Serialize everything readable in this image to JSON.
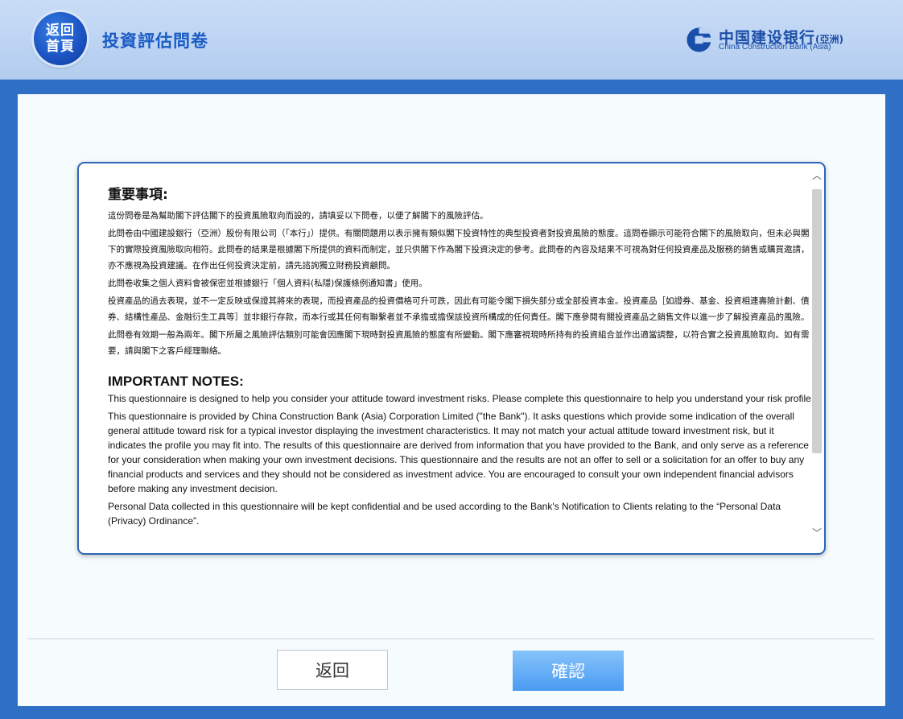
{
  "header": {
    "home_line1": "返回",
    "home_line2": "首頁",
    "title": "投資評估問卷",
    "logo_cn": "中国建设银行",
    "logo_cn_suffix": "(亞洲)",
    "logo_en": "China Construction Bank (Asia)",
    "icons": {
      "home": "home-circle-button",
      "logo": "ccb-logo-icon"
    }
  },
  "notice": {
    "heading_cn": "重要事項:",
    "paragraphs_cn": [
      "這份問卷是為幫助閣下評估閣下的投資風險取向而設的，請填妥以下問卷，以便了解閣下的風險評估。",
      "此問卷由中國建設銀行（亞洲）股份有限公司（「本行」）提供。有關問題用以表示擁有類似閣下投資特性的典型投資者對投資風險的態度。這問卷顯示可能符合閣下的風險取向，但未必與閣下的實際投資風險取向相符。此問卷的結果是根據閣下所提供的資料而制定，並只供閣下作為閣下投資決定的參考。此問卷的內容及結果不可視為對任何投資產品及服務的銷售或購買邀請，亦不應視為投資建議。在作出任何投資決定前，請先諮詢獨立財務投資顧問。",
      "此問卷收集之個人資料會被保密並根據銀行「個人資料(私隱)保護條例通知書」使用。",
      "投資產品的過去表現，並不一定反映或保證其將來的表現，而投資產品的投資價格可升可跌，因此有可能令閣下損失部分或全部投資本金。投資產品［如證券、基金、投資相連壽險計劃、債券、結構性產品、金融衍生工具等］並非銀行存款，而本行或其任何有聯繫者並不承擔或擔保該投資所構成的任何責任。閣下應參閱有關投資產品之銷售文件以進一步了解投資產品的風險。",
      "此問卷有效期一般為兩年。閣下所屬之風險評估類別可能會因應閣下現時對投資風險的態度有所變動。閣下應審視現時所持有的投資組合並作出適當調整，以符合實之投資風險取向。如有需要，請與閣下之客戶經理聯絡。"
    ],
    "heading_en": "IMPORTANT NOTES:",
    "paragraphs_en": [
      "This questionnaire is designed to help you consider your attitude toward investment risks. Please complete this questionnaire to help you understand your risk profile.",
      "This questionnaire is provided by China Construction Bank (Asia) Corporation Limited (\"the Bank\"). It asks questions which provide some indication of the overall general attitude toward risk for a typical investor displaying the investment characteristics. It may not match your actual attitude toward investment risk, but it indicates the profile you may fit into. The results of this questionnaire are derived from information that you have provided to the Bank, and only serve as a reference for your consideration when making your own investment decisions. This questionnaire and the results are not an offer to sell or a solicitation for an offer to buy any financial products and services and they should not be considered as investment advice. You are encouraged to consult your own independent financial advisors before making any investment decision.",
      "Personal Data collected in this questionnaire will be kept confidential and be used according to the Bank's Notification to Clients relating to the “Personal Data (Privacy) Ordinance”."
    ]
  },
  "buttons": {
    "back": "返回",
    "confirm": "確認"
  },
  "colors": {
    "header_bg": "#bcd3f3",
    "page_bg": "#2f6fc6",
    "title": "#1b5bc4",
    "confirm_bg": "#5aa9f5"
  }
}
